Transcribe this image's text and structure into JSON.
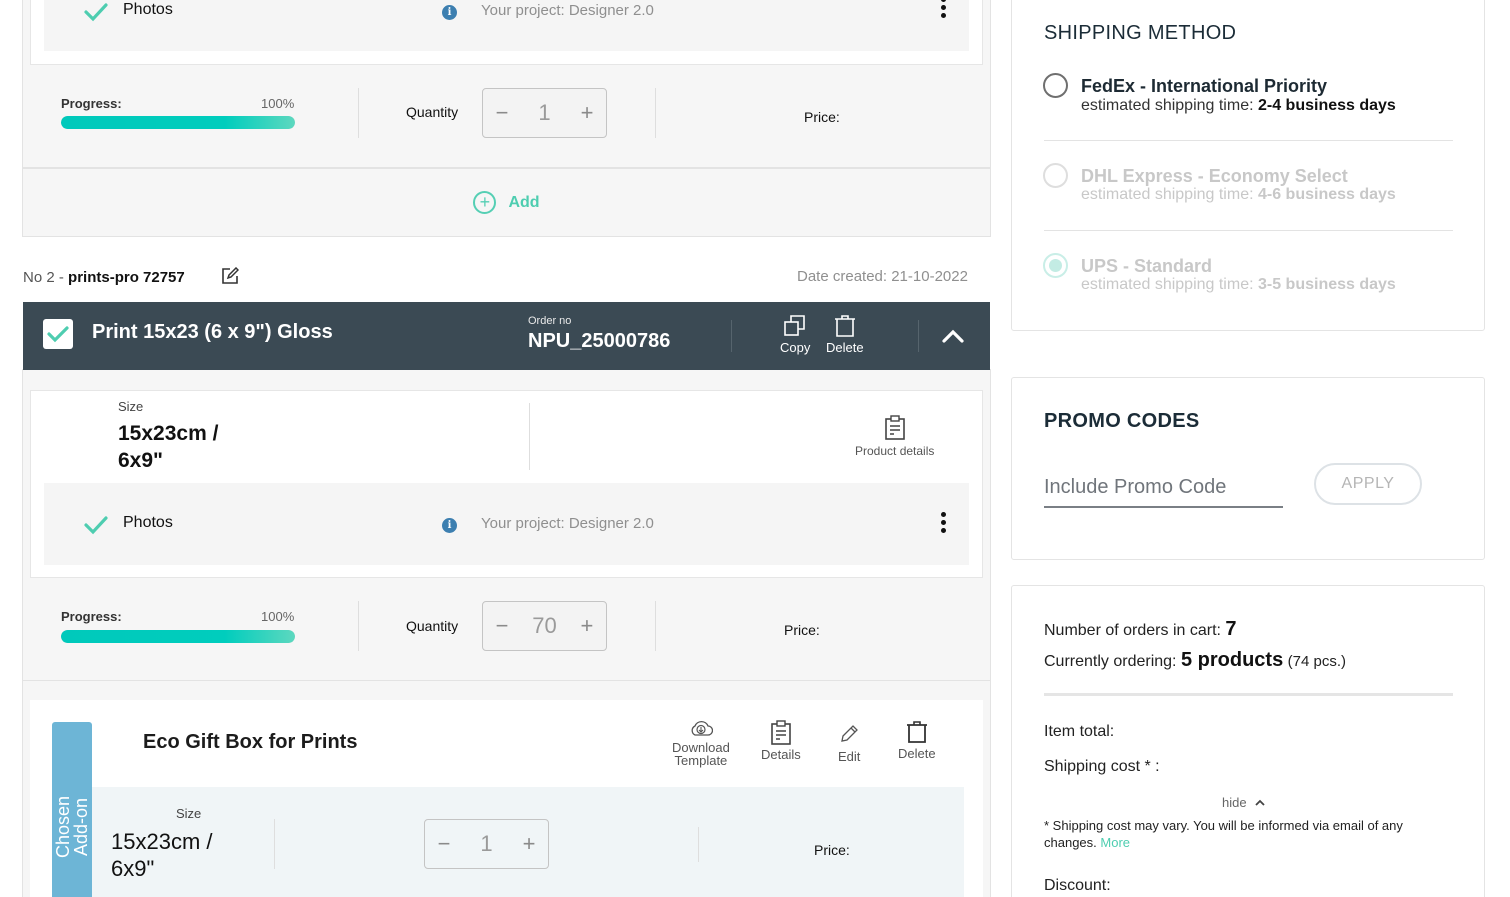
{
  "order1": {
    "photos_label": "Photos",
    "project_label": "Your project:",
    "project_value": "Designer 2.0",
    "progress_label": "Progress:",
    "progress_percent_text": "100%",
    "progress_fraction": 1.0,
    "quantity_label": "Quantity",
    "quantity_value": "1",
    "minus": "−",
    "plus": "+",
    "price_label": "Price:",
    "add_label": "Add",
    "add_icon": "plus-circle-icon"
  },
  "order2": {
    "number_prefix": "No 2 -",
    "name": "prints-pro 72757",
    "date_created": "Date created: 21-10-2022",
    "title": "Print 15x23 (6 x 9\") Gloss",
    "order_no_label": "Order no",
    "order_no_value": "NPU_25000786",
    "actions": {
      "copy": "Copy",
      "delete": "Delete"
    },
    "size_label": "Size",
    "size_value_line1": "15x23cm /",
    "size_value_line2": "6x9\"",
    "product_details_label": "Product details",
    "photos_label": "Photos",
    "project_label": "Your project:",
    "project_value": "Designer 2.0",
    "progress_label": "Progress:",
    "progress_percent_text": "100%",
    "progress_fraction": 1.0,
    "quantity_label": "Quantity",
    "quantity_value": "70",
    "minus": "−",
    "plus": "+",
    "price_label": "Price:"
  },
  "addon": {
    "tab_label_line1": "Chosen",
    "tab_label_line2": "Add-on",
    "title": "Eco Gift Box for Prints",
    "actions": {
      "download_line1": "Download",
      "download_line2": "Template",
      "details": "Details",
      "edit": "Edit",
      "delete": "Delete"
    },
    "size_label": "Size",
    "size_value_line1": "15x23cm /",
    "size_value_line2": "6x9\"",
    "quantity_value": "1",
    "minus": "−",
    "plus": "+",
    "price_label": "Price:"
  },
  "shipping": {
    "title": "SHIPPING METHOD",
    "options": [
      {
        "name": "FedEx - International Priority",
        "time_label": "estimated shipping time:",
        "time_value": "2-4 business days",
        "state": "enabled-unchecked"
      },
      {
        "name": "DHL Express - Economy Select",
        "time_label": "estimated shipping time:",
        "time_value": "4-6 business days",
        "state": "disabled-unchecked"
      },
      {
        "name": "UPS - Standard",
        "time_label": "estimated shipping time:",
        "time_value": "3-5 business days",
        "state": "disabled-checked"
      }
    ]
  },
  "promo": {
    "title": "PROMO CODES",
    "input_placeholder": "Include Promo Code",
    "input_value": "",
    "apply_label": "APPLY"
  },
  "summary": {
    "orders_in_cart_label": "Number of orders in cart:",
    "orders_in_cart_value": "7",
    "currently_ordering_label": "Currently ordering:",
    "currently_ordering_value": "5 products",
    "currently_ordering_pcs": "(74 pcs.)",
    "item_total_label": "Item total:",
    "shipping_cost_label": "Shipping cost * :",
    "hide_label": "hide",
    "note_text": "* Shipping cost may vary. You will be informed via email of any changes.",
    "note_link": "More",
    "discount_label": "Discount:"
  },
  "colors": {
    "accent_teal": "#4ecdb0",
    "header_dark": "#3b4a54",
    "addon_blue": "#6db5d6",
    "info_blue": "#3d7fb0"
  }
}
